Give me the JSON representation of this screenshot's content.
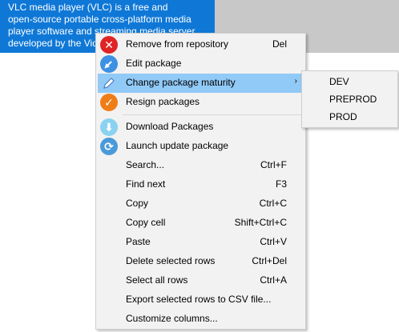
{
  "cell": {
    "lines": [
      "VLC media player (VLC) is a free and",
      "open-source portable cross-platform media",
      "player software and streaming media server",
      "developed by the Vid"
    ]
  },
  "menu": {
    "items": [
      {
        "label": "Remove from repository",
        "shortcut": "Del",
        "icon": "remove-icon"
      },
      {
        "label": "Edit package",
        "shortcut": "",
        "icon": "edit-icon"
      },
      {
        "label": "Change package maturity",
        "shortcut": "",
        "icon": "pencil-icon",
        "submenu_arrow": "›"
      },
      {
        "label": "Resign packages",
        "shortcut": "",
        "icon": "resign-icon"
      },
      {
        "label": "Download Packages",
        "shortcut": "",
        "icon": "download-icon"
      },
      {
        "label": "Launch update package",
        "shortcut": "",
        "icon": "refresh-icon"
      },
      {
        "label": "Search...",
        "shortcut": "Ctrl+F"
      },
      {
        "label": "Find next",
        "shortcut": "F3"
      },
      {
        "label": "Copy",
        "shortcut": "Ctrl+C"
      },
      {
        "label": "Copy cell",
        "shortcut": "Shift+Ctrl+C"
      },
      {
        "label": "Paste",
        "shortcut": "Ctrl+V"
      },
      {
        "label": "Delete selected rows",
        "shortcut": "Ctrl+Del"
      },
      {
        "label": "Select all rows",
        "shortcut": "Ctrl+A"
      },
      {
        "label": "Export selected rows to CSV file...",
        "shortcut": ""
      },
      {
        "label": "Customize columns...",
        "shortcut": ""
      }
    ]
  },
  "submenu": {
    "items": [
      "DEV",
      "PREPROD",
      "PROD"
    ]
  },
  "colors": {
    "selection": "#0f78d7",
    "menu_highlight": "#91c9f7",
    "menu_background": "#f2f2f2"
  }
}
